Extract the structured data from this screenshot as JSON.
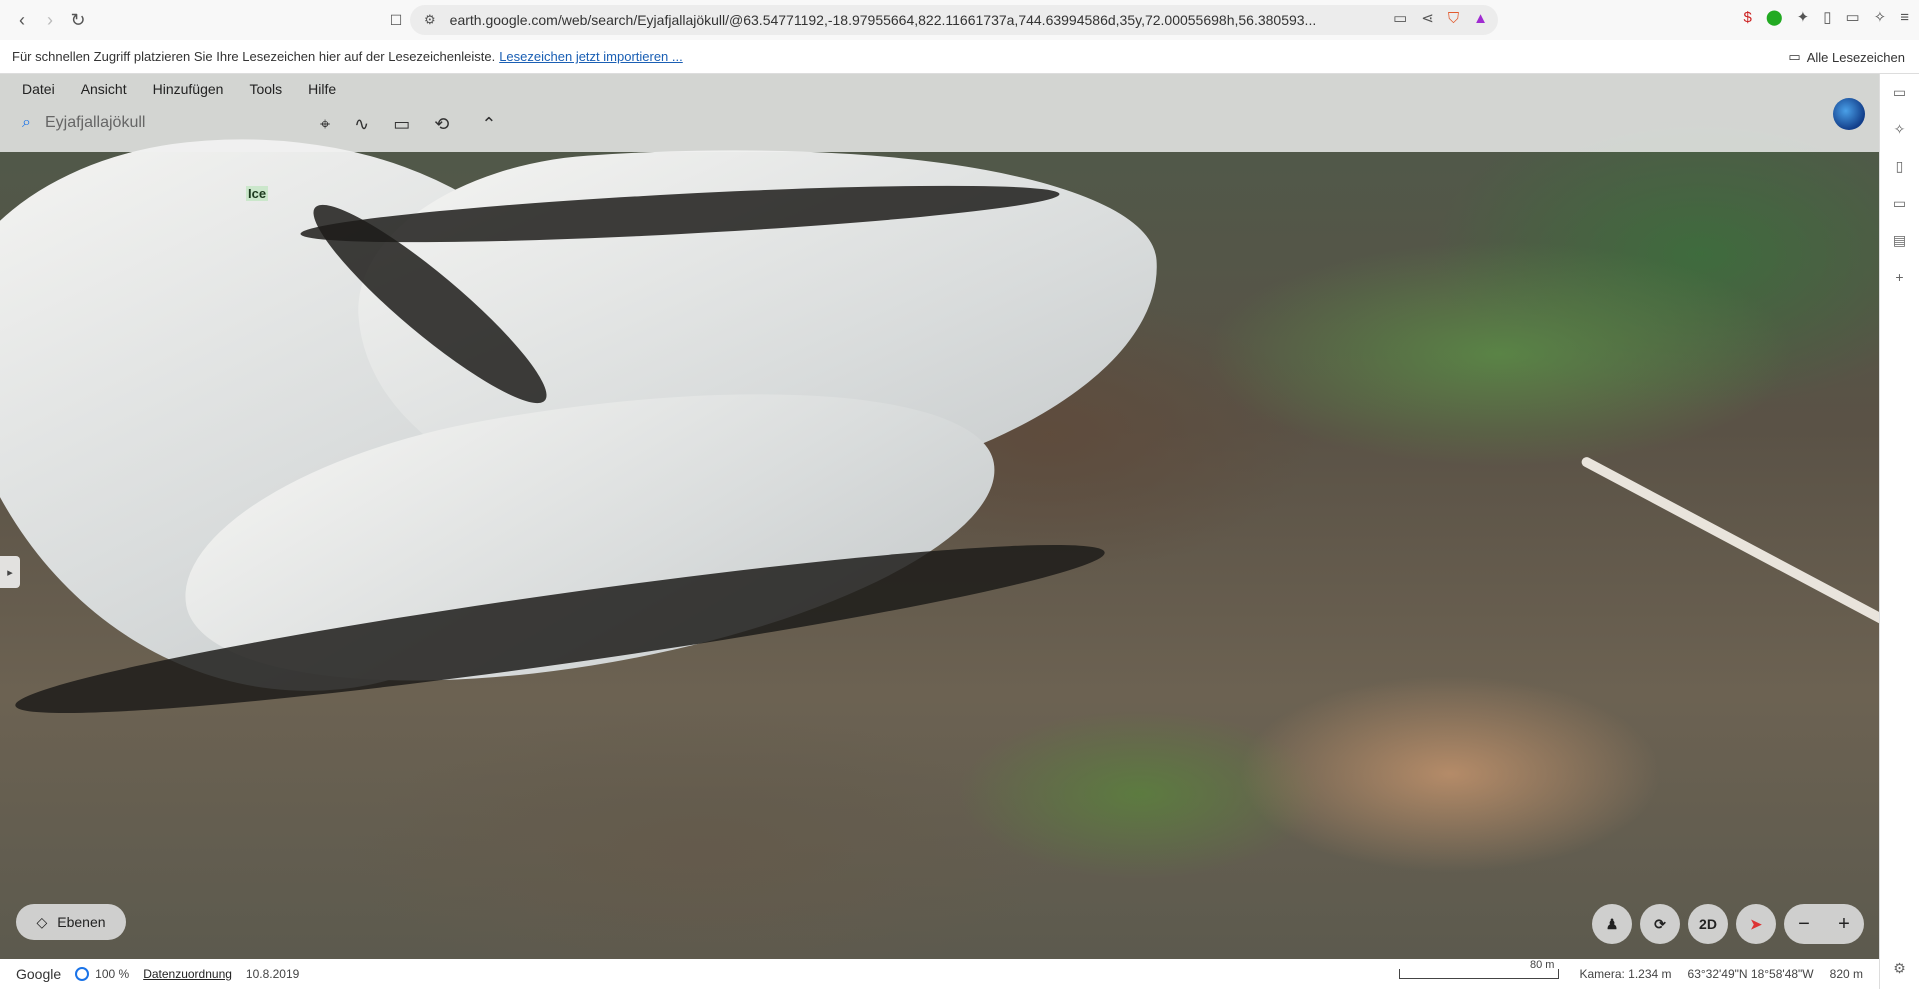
{
  "browser": {
    "url": "earth.google.com/web/search/Eyjafjallajökull/@63.54771192,-18.97955664,822.11661737a,744.63994586d,35y,72.00055698h,56.380593..."
  },
  "bookmarks": {
    "hint": "Für schnellen Zugriff platzieren Sie Ihre Lesezeichen hier auf der Lesezeichenleiste.",
    "import_link": "Lesezeichen jetzt importieren ...",
    "all_bookmarks": "Alle Lesezeichen"
  },
  "menu": [
    "Datei",
    "Ansicht",
    "Hinzufügen",
    "Tools",
    "Hilfe"
  ],
  "search": {
    "value": "Eyjafjallajökull"
  },
  "map": {
    "label": "Ice"
  },
  "controls": {
    "layers_label": "Ebenen",
    "view_2d": "2D"
  },
  "status": {
    "brand": "Google",
    "percent": "100 %",
    "attribution": "Datenzuordnung",
    "date": "10.8.2019",
    "scale": "80 m",
    "camera": "Kamera: 1.234 m",
    "coords": "63°32'49\"N 18°58'48\"W",
    "elevation": "820 m"
  }
}
